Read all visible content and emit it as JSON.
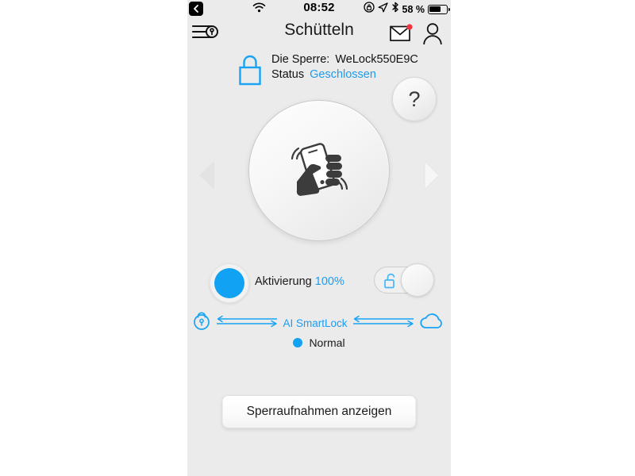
{
  "status_bar": {
    "back_icon": "back-chevron-icon",
    "wifi_icon": "wifi-icon",
    "time": "08:52",
    "rotation_lock_icon": "rotation-lock-icon",
    "location_icon": "location-arrow-icon",
    "bluetooth_icon": "bluetooth-icon",
    "battery_percent": "58 %",
    "battery_level": 58,
    "battery_icon": "battery-icon"
  },
  "header": {
    "menu_icon": "menu-lock-icon",
    "title": "Schütteln",
    "mail_icon": "mail-envelope-icon",
    "mail_badge": true,
    "profile_icon": "profile-person-icon"
  },
  "lock_info": {
    "padlock_icon": "padlock-closed-icon",
    "lock_label": "Die Sperre:",
    "lock_name": "WeLock550E9C",
    "status_label": "Status",
    "status_value": "Geschlossen"
  },
  "help": {
    "label": "?",
    "icon": "question-mark-icon"
  },
  "main": {
    "shake_icon": "hand-shaking-phone-icon",
    "prev_arrow_icon": "chevron-left-icon",
    "next_arrow_icon": "chevron-right-icon"
  },
  "activation": {
    "indicator_icon": "blue-circle-indicator",
    "label": "Aktivierung",
    "percent": "100%",
    "toggle_icon": "padlock-open-icon",
    "toggle_state": "on"
  },
  "connection": {
    "left_icon": "lock-circle-icon",
    "left_arrows_icon": "double-arrow-icon",
    "label": "AI SmartLock",
    "right_arrows_icon": "double-arrow-icon",
    "right_icon": "cloud-icon",
    "status_dot_color": "#11a2f3",
    "status_label": "Normal"
  },
  "bottom": {
    "records_button": "Sperraufnahmen anzeigen"
  },
  "colors": {
    "accent_blue": "#1c9cf0",
    "dot_blue": "#11a2f3",
    "badge_red": "#f5333f",
    "screen_bg": "#ebebeb"
  }
}
